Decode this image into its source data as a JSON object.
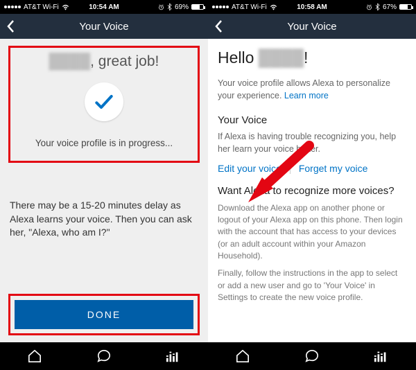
{
  "left": {
    "status": {
      "carrier": "AT&T Wi-Fi",
      "time": "10:54 AM",
      "battery": "69%"
    },
    "nav_title": "Your Voice",
    "great_job_prefix": "",
    "great_job_suffix": ", great job!",
    "progress_text": "Your voice profile is in progress...",
    "delay_text": "There may be a 15-20 minutes delay as Alexa learns your voice. Then you can ask her, \"Alexa, who am I?\"",
    "done_label": "DONE"
  },
  "right": {
    "status": {
      "carrier": "AT&T Wi-Fi",
      "time": "10:58 AM",
      "battery": "67%"
    },
    "nav_title": "Your Voice",
    "hello_prefix": "Hello ",
    "hello_suffix": "!",
    "intro": "Your voice profile allows Alexa to personalize your experience. ",
    "learn_more": "Learn more",
    "section1_head": "Your Voice",
    "section1_body": "If Alexa is having trouble recognizing you, help her learn your voice better.",
    "edit_link": "Edit your voice",
    "forget_link": "Forget my voice",
    "section2_head": "Want Alexa to recognize more voices?",
    "section2_p1": "Download the Alexa app on another phone or logout of your Alexa app on this phone. Then login with the account that has access to your devices (or an adult account within your Amazon Household).",
    "section2_p2": "Finally, follow the instructions in the app to select or add a new user and go to 'Your Voice' in Settings to create the new voice profile."
  },
  "masked_name": "████"
}
